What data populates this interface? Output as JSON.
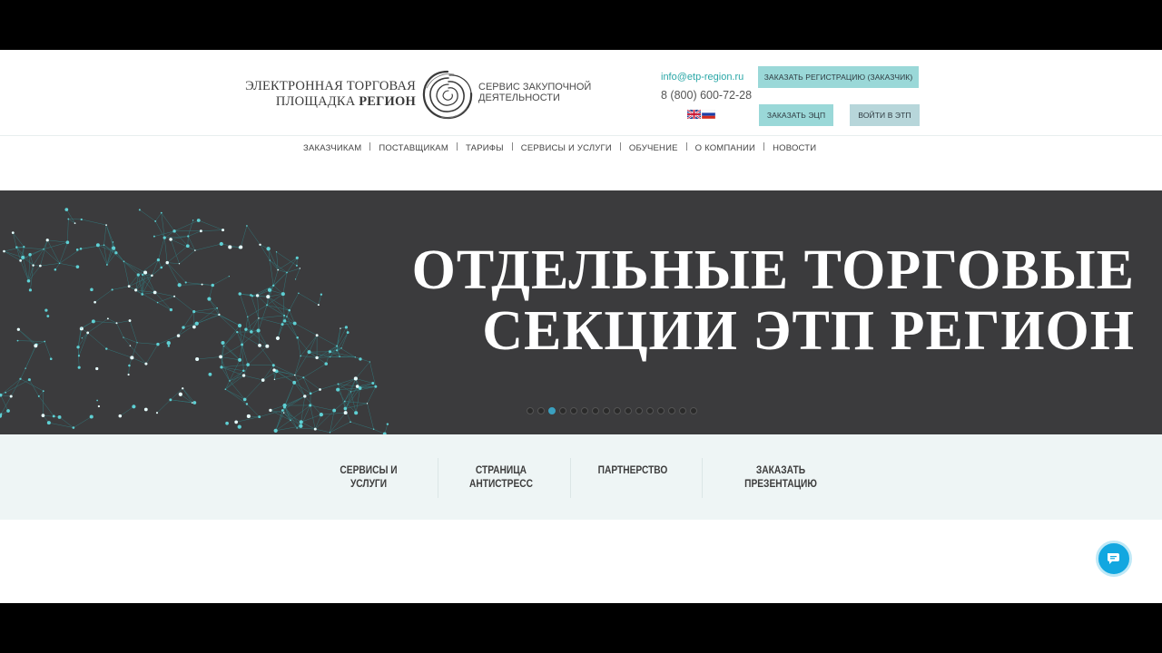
{
  "header": {
    "logo": {
      "line1": "ЭЛЕКТРОННАЯ ТОРГОВАЯ",
      "line2_plain": "ПЛОЩАДКА ",
      "line2_bold": "РЕГИОН",
      "service_line1": "СЕРВИС ЗАКУПОЧНОЙ",
      "service_line2": "ДЕЯТЕЛЬНОСТИ"
    },
    "email": "info@etp-region.ru",
    "phone": "8 (800) 600-72-28",
    "buttons": {
      "register": "ЗАКАЗАТЬ РЕГИСТРАЦИЮ (ЗАКАЗЧИК)",
      "ecp": "ЗАКАЗАТЬ ЭЦП",
      "login": "ВОЙТИ В ЭТП"
    }
  },
  "nav": [
    "ЗАКАЗЧИКАМ",
    "ПОСТАВЩИКАМ",
    "ТАРИФЫ",
    "СЕРВИСЫ И УСЛУГИ",
    "ОБУЧЕНИЕ",
    "О КОМПАНИИ",
    "НОВОСТИ"
  ],
  "banner": {
    "line1": "ОТДЕЛЬНЫЕ ТОРГОВЫЕ",
    "line2": "СЕКЦИИ ЭТП РЕГИОН",
    "slide_count": 16,
    "active_slide": 3
  },
  "quick_links": [
    {
      "line1": "СЕРВИСЫ И",
      "line2": "УСЛУГИ"
    },
    {
      "line1": "СТРАНИЦА",
      "line2": "АНТИСТРЕСС"
    },
    {
      "line1": "ПАРТНЕРСТВО",
      "line2": ""
    },
    {
      "line1": "ЗАКАЗАТЬ",
      "line2": "ПРЕЗЕНТАЦИЮ"
    }
  ],
  "colors": {
    "accent": "#2aa7a7",
    "button": "#9ad8d8",
    "banner_bg": "#3b3b3d",
    "chat": "#12a7e0"
  },
  "icons": {
    "chat": "chat-bubble-icon"
  }
}
